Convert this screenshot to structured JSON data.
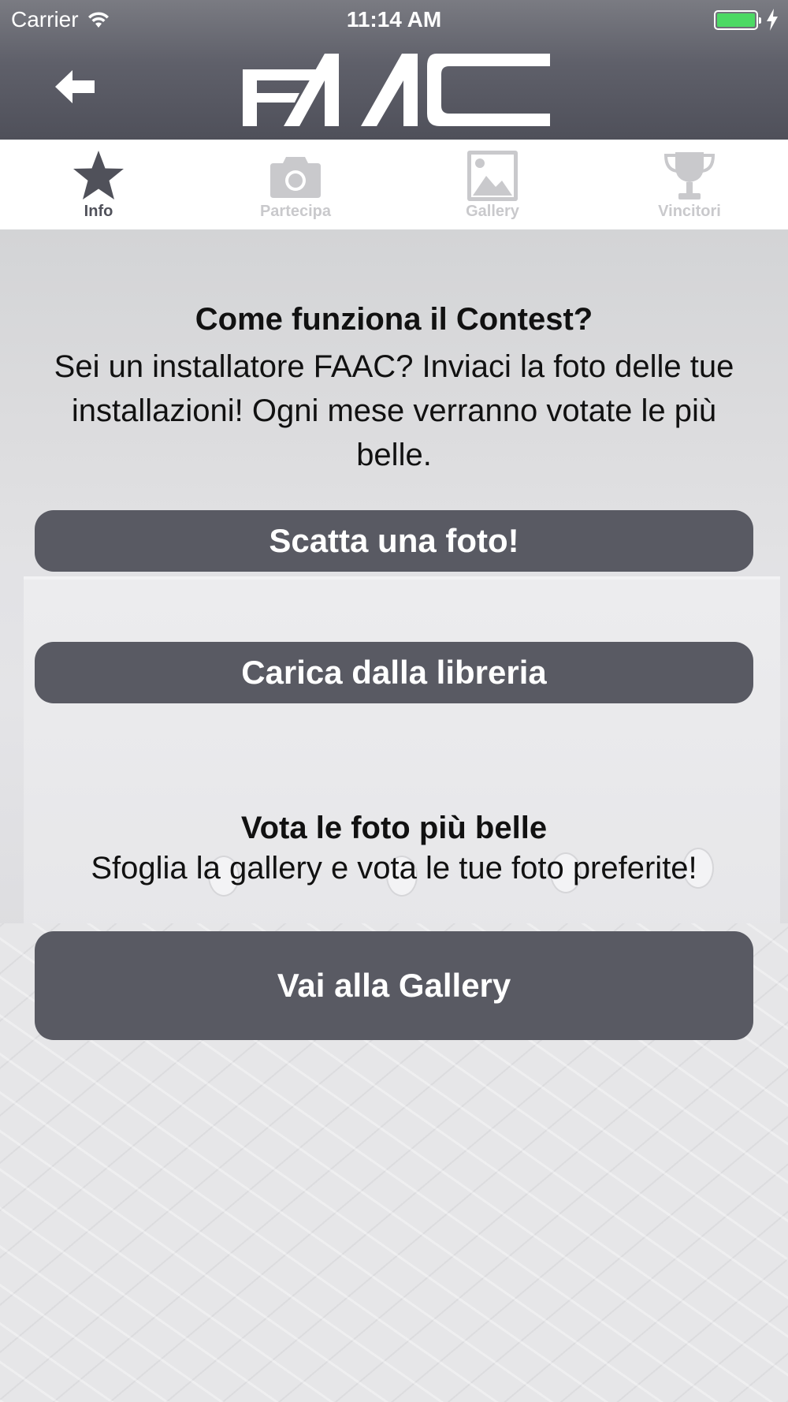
{
  "status_bar": {
    "carrier": "Carrier",
    "time": "11:14 AM",
    "battery_level": 1.0,
    "battery_color": "#4cd964"
  },
  "header": {
    "back_icon": "back-arrow-icon",
    "logo_text": "FAAC"
  },
  "tabs": [
    {
      "label": "Info",
      "icon": "star-icon",
      "active": true
    },
    {
      "label": "Partecipa",
      "icon": "camera-icon",
      "active": false
    },
    {
      "label": "Gallery",
      "icon": "image-icon",
      "active": false
    },
    {
      "label": "Vincitori",
      "icon": "trophy-icon",
      "active": false
    }
  ],
  "contest": {
    "title": "Come funziona il Contest?",
    "description": "Sei un installatore FAAC? Inviaci la foto delle tue installazioni! Ogni mese verranno votate le più belle.",
    "take_photo_label": "Scatta una foto!",
    "upload_label": "Carica dalla libreria"
  },
  "vote": {
    "title": "Vota le foto più belle",
    "description": "Sfoglia la gallery e vota le tue foto preferite!",
    "gallery_button_label": "Vai alla Gallery"
  },
  "colors": {
    "header": "#5f606a",
    "button": "#595a63",
    "tab_active": "#50515a",
    "tab_inactive": "#c9c9cc"
  }
}
